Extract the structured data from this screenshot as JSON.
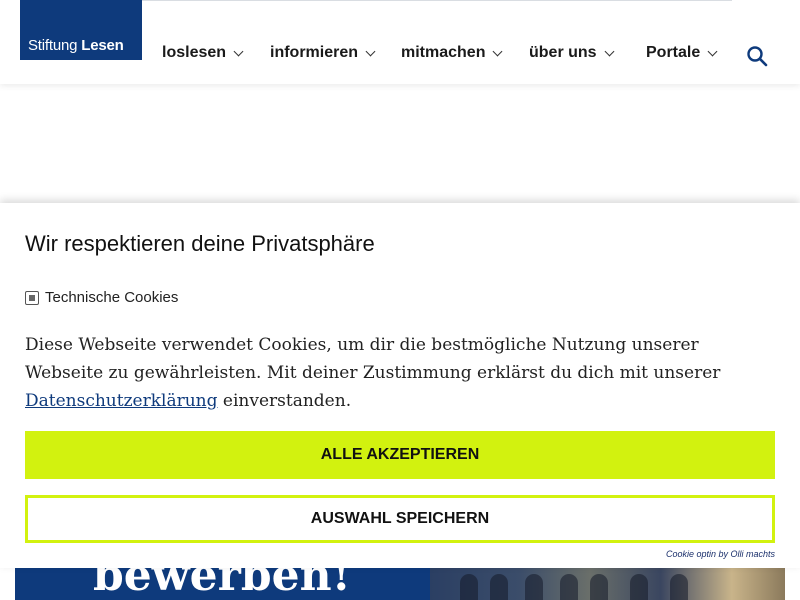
{
  "header": {
    "logo": {
      "prefix": "Stiftung",
      "brand": "Lesen"
    },
    "nav": [
      {
        "label": "loslesen"
      },
      {
        "label": "informieren"
      },
      {
        "label": "mitmachen"
      },
      {
        "label": "über uns"
      },
      {
        "label": "Portale"
      }
    ],
    "search_icon": "search-icon"
  },
  "cookie_banner": {
    "title": "Wir respektieren deine Privatsphäre",
    "checkbox_label": "Technische Cookies",
    "text_before": "Diese Webseite verwendet Cookies, um dir die bestmögliche Nutzung unserer Webseite zu gewährleisten. Mit deiner Zustimmung erklärst du dich mit unserer ",
    "link": "Datenschutzerklärung",
    "text_after": " einverstanden.",
    "accept_label": "ALLE AKZEPTIEREN",
    "save_label": "AUSWAHL SPEICHERN",
    "credit": "Cookie optin by Olli machts"
  },
  "page": {
    "promo_text": "bewerben!"
  },
  "colors": {
    "brand_blue": "#0e3a7c",
    "accent_lime": "#d2f20f"
  }
}
